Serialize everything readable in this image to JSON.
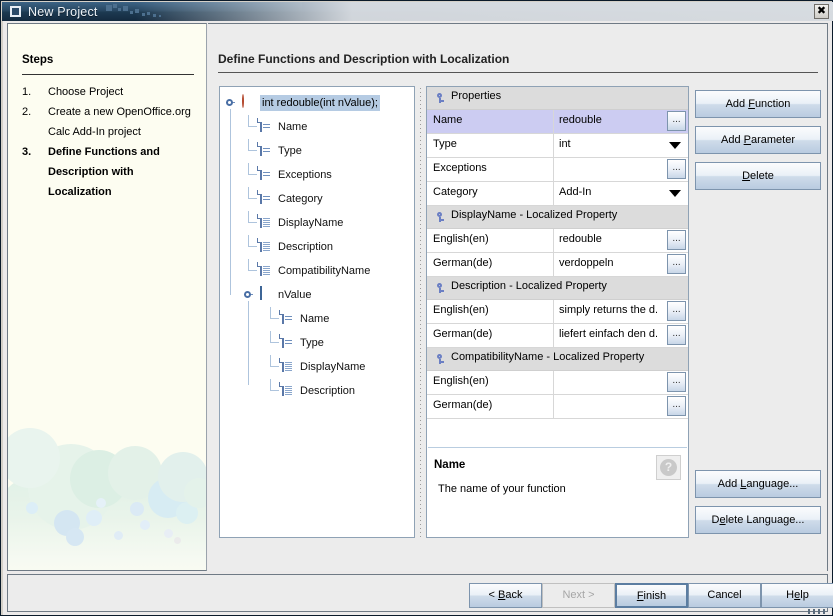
{
  "window": {
    "title": "New Project",
    "close_label": "✖",
    "icon": "window-icon"
  },
  "steps": {
    "heading": "Steps",
    "items": [
      {
        "num": "1.",
        "label": "Choose Project",
        "current": false
      },
      {
        "num": "2.",
        "label": "Create a new OpenOffice.org",
        "current": false
      },
      {
        "num": "",
        "label": "Calc Add-In project",
        "current": false
      },
      {
        "num": "3.",
        "label": "Define Functions and",
        "current": true
      },
      {
        "num": "",
        "label": "Description with",
        "current": true
      },
      {
        "num": "",
        "label": "Localization",
        "current": true
      }
    ]
  },
  "page": {
    "title": "Define Functions and Description with Localization"
  },
  "tree": {
    "nodes": [
      {
        "label": "int redouble(int nValue);",
        "icon": "function-circle-icon",
        "depth": 0,
        "selected": true,
        "expander": true
      },
      {
        "label": "Name",
        "icon": "document-icon",
        "depth": 1,
        "selected": false,
        "expander": false
      },
      {
        "label": "Type",
        "icon": "document-icon",
        "depth": 1,
        "selected": false,
        "expander": false
      },
      {
        "label": "Exceptions",
        "icon": "document-icon",
        "depth": 1,
        "selected": false,
        "expander": false
      },
      {
        "label": "Category",
        "icon": "document-icon",
        "depth": 1,
        "selected": false,
        "expander": false
      },
      {
        "label": "DisplayName",
        "icon": "document-lines-icon",
        "depth": 1,
        "selected": false,
        "expander": false
      },
      {
        "label": "Description",
        "icon": "document-lines-icon",
        "depth": 1,
        "selected": false,
        "expander": false
      },
      {
        "label": "CompatibilityName",
        "icon": "document-lines-icon",
        "depth": 1,
        "selected": false,
        "expander": false
      },
      {
        "label": "nValue",
        "icon": "parameter-square-icon",
        "depth": 1,
        "selected": false,
        "expander": true
      },
      {
        "label": "Name",
        "icon": "document-icon",
        "depth": 2,
        "selected": false,
        "expander": false
      },
      {
        "label": "Type",
        "icon": "document-icon",
        "depth": 2,
        "selected": false,
        "expander": false
      },
      {
        "label": "DisplayName",
        "icon": "document-lines-icon",
        "depth": 2,
        "selected": false,
        "expander": false
      },
      {
        "label": "Description",
        "icon": "document-lines-icon",
        "depth": 2,
        "selected": false,
        "expander": false
      }
    ]
  },
  "properties": {
    "rows": [
      {
        "kind": "group",
        "label": "Properties"
      },
      {
        "kind": "row",
        "name": "Name",
        "value": "redouble",
        "editor": "ellipsis",
        "selected": true
      },
      {
        "kind": "row",
        "name": "Type",
        "value": "int",
        "editor": "combo",
        "selected": false
      },
      {
        "kind": "row",
        "name": "Exceptions",
        "value": "",
        "editor": "ellipsis",
        "selected": false
      },
      {
        "kind": "row",
        "name": "Category",
        "value": "Add-In",
        "editor": "combo",
        "selected": false
      },
      {
        "kind": "group",
        "label": "DisplayName - Localized Property"
      },
      {
        "kind": "row",
        "name": "English(en)",
        "value": "redouble",
        "editor": "ellipsis",
        "selected": false
      },
      {
        "kind": "row",
        "name": "German(de)",
        "value": "verdoppeln",
        "editor": "ellipsis",
        "selected": false
      },
      {
        "kind": "group",
        "label": "Description - Localized Property"
      },
      {
        "kind": "row",
        "name": "English(en)",
        "value": "simply returns the d...",
        "editor": "ellipsis",
        "selected": false
      },
      {
        "kind": "row",
        "name": "German(de)",
        "value": "liefert einfach den d...",
        "editor": "ellipsis",
        "selected": false
      },
      {
        "kind": "group",
        "label": "CompatibilityName - Localized Property"
      },
      {
        "kind": "row",
        "name": "English(en)",
        "value": "",
        "editor": "ellipsis",
        "selected": false
      },
      {
        "kind": "row",
        "name": "German(de)",
        "value": "",
        "editor": "ellipsis",
        "selected": false
      },
      {
        "kind": "blank"
      }
    ],
    "description": {
      "title": "Name",
      "text": "The name of your function",
      "help_glyph": "?"
    }
  },
  "side_buttons": {
    "add_function": {
      "pre": "Add ",
      "mnemonic": "F",
      "post": "unction"
    },
    "add_parameter": {
      "pre": "Add ",
      "mnemonic": "P",
      "post": "arameter"
    },
    "delete": {
      "pre": "",
      "mnemonic": "D",
      "post": "elete"
    },
    "add_language": {
      "pre": "Add ",
      "mnemonic": "L",
      "post": "anguage..."
    },
    "delete_language": {
      "pre": "D",
      "mnemonic": "e",
      "post": "lete Language..."
    }
  },
  "footer": {
    "back": {
      "pre": "< ",
      "mnemonic": "B",
      "post": "ack",
      "disabled": false,
      "focus": false
    },
    "next": {
      "pre": "Next >",
      "mnemonic": "",
      "post": "",
      "disabled": true,
      "focus": false
    },
    "finish": {
      "pre": "",
      "mnemonic": "F",
      "post": "inish",
      "disabled": false,
      "focus": true
    },
    "cancel": {
      "pre": "Cancel",
      "mnemonic": "",
      "post": "",
      "disabled": false,
      "focus": false
    },
    "help": {
      "pre": "H",
      "mnemonic": "e",
      "post": "lp",
      "disabled": false,
      "focus": false
    }
  },
  "colors": {
    "title_bar": "#24425f",
    "selection": "#b5cbe3",
    "prop_selection": "#ccccf2",
    "group_row": "#dcdcdc",
    "panel": "#ececec",
    "steps_bg": "#fdfdf1"
  }
}
